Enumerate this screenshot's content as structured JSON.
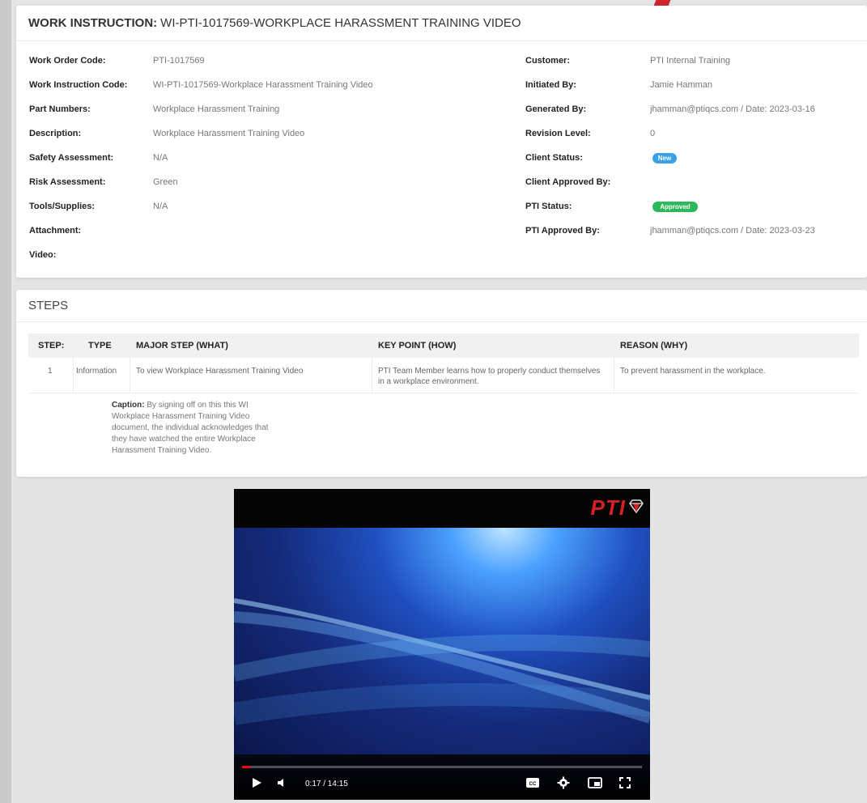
{
  "header": {
    "prefix": "WORK INSTRUCTION:",
    "title": "WI-PTI-1017569-WORKPLACE HARASSMENT TRAINING VIDEO"
  },
  "info_left": [
    {
      "label": "Work Order Code:",
      "value": "PTI-1017569"
    },
    {
      "label": "Work Instruction Code:",
      "value": "WI-PTI-1017569-Workplace Harassment Training Video"
    },
    {
      "label": "Part Numbers:",
      "value": "Workplace Harassment Training"
    },
    {
      "label": "Description:",
      "value": "Workplace Harassment Training Video"
    },
    {
      "label": "Safety Assessment:",
      "value": "N/A"
    },
    {
      "label": "Risk Assessment:",
      "value": "Green"
    },
    {
      "label": "Tools/Supplies:",
      "value": "N/A"
    },
    {
      "label": "Attachment:",
      "value": ""
    },
    {
      "label": "Video:",
      "value": ""
    }
  ],
  "info_right": [
    {
      "label": "Customer:",
      "value": "PTI Internal Training"
    },
    {
      "label": "Initiated By:",
      "value": "Jamie Hamman"
    },
    {
      "label": "Generated By:",
      "value": "jhamman@ptiqcs.com / Date: 2023-03-16"
    },
    {
      "label": "Revision Level:",
      "value": "0"
    },
    {
      "label": "Client Status:",
      "value": ""
    },
    {
      "label": "Client Approved By:",
      "value": ""
    },
    {
      "label": "PTI Status:",
      "value": ""
    },
    {
      "label": "PTI Approved By:",
      "value": "jhamman@ptiqcs.com / Date: 2023-03-23"
    }
  ],
  "badges": {
    "client_status": {
      "text": "New",
      "color": "#3aa0e8"
    },
    "pti_status": {
      "text": "Approved",
      "color": "#2eb85c"
    }
  },
  "steps": {
    "title": "STEPS",
    "columns": [
      "STEP:",
      "TYPE",
      "MAJOR STEP (WHAT)",
      "KEY POINT (HOW)",
      "REASON (WHY)"
    ],
    "rows": [
      {
        "step": "1",
        "type": "Information",
        "what": "To view Workplace Harassment Training Video",
        "how": "PTI Team Member learns how to properly conduct themselves in a workplace environment.",
        "why": "To prevent harassment in the workplace."
      }
    ],
    "caption_label": "Caption:",
    "caption_text": "By signing off on this this WI Workplace Harassment Training Video document, the individual acknowledges that they have watched the entire Workplace Harassment Training Video."
  },
  "video": {
    "logo_text": "PTI",
    "current_time": "0:17",
    "duration": "14:15",
    "time_display": "0:17 / 14:15",
    "progress": 0.02,
    "icons": [
      "play-icon",
      "volume-icon",
      "captions-icon",
      "settings-icon",
      "miniplayer-icon",
      "fullscreen-icon"
    ]
  },
  "colors": {
    "accent_red": "#d91f26",
    "progress_red": "#ff0000"
  }
}
